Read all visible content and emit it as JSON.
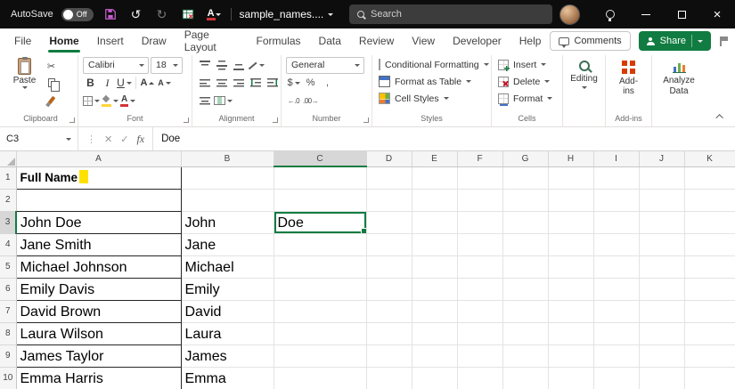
{
  "titlebar": {
    "autosave_label": "AutoSave",
    "autosave_state": "Off",
    "doc_title": "sample_names....",
    "search_placeholder": "Search"
  },
  "tabs": {
    "file": "File",
    "home": "Home",
    "insert": "Insert",
    "draw": "Draw",
    "page_layout": "Page Layout",
    "formulas": "Formulas",
    "data": "Data",
    "review": "Review",
    "view": "View",
    "developer": "Developer",
    "help": "Help",
    "active": "Home",
    "comments_label": "Comments",
    "share_label": "Share"
  },
  "ribbon": {
    "paste": "Paste",
    "clipboard_group": "Clipboard",
    "font_name": "Calibri",
    "font_size": "18",
    "font_group": "Font",
    "alignment_group": "Alignment",
    "number_format": "General",
    "number_group": "Number",
    "conditional_formatting": "Conditional Formatting",
    "format_as_table": "Format as Table",
    "cell_styles": "Cell Styles",
    "styles_group": "Styles",
    "insert": "Insert",
    "delete": "Delete",
    "format": "Format",
    "cells_group": "Cells",
    "editing": "Editing",
    "addins": "Add-ins",
    "addins_group": "Add-ins",
    "analyze_data": "Analyze Data"
  },
  "glyphs": {
    "undo": "↺",
    "redo": "↻",
    "cut": "✂",
    "bold": "B",
    "italic": "I",
    "underline": "U",
    "A": "A",
    "dollar": "$",
    "percent": "%",
    "comma": ",",
    "inc_decimal": "←.0",
    "dec_decimal": ".00→",
    "more": "⋮",
    "cancel": "✕",
    "check": "✓",
    "fx": "fx",
    "close": "×"
  },
  "formula_bar": {
    "name_box": "C3",
    "value": "Doe"
  },
  "sheet": {
    "columns": [
      "A",
      "B",
      "C",
      "D",
      "E",
      "F",
      "G",
      "H",
      "I",
      "J",
      "K"
    ],
    "selected_cell": "C3",
    "rows": [
      {
        "n": "1",
        "a": "Full Name",
        "b": "",
        "c": ""
      },
      {
        "n": "2",
        "a": "",
        "b": "",
        "c": ""
      },
      {
        "n": "3",
        "a": "John Doe",
        "b": "John",
        "c": "Doe"
      },
      {
        "n": "4",
        "a": "Jane Smith",
        "b": "Jane",
        "c": ""
      },
      {
        "n": "5",
        "a": "Michael Johnson",
        "b": "Michael",
        "c": ""
      },
      {
        "n": "6",
        "a": "Emily Davis",
        "b": "Emily",
        "c": ""
      },
      {
        "n": "7",
        "a": "David Brown",
        "b": "David",
        "c": ""
      },
      {
        "n": "8",
        "a": "Laura Wilson",
        "b": "Laura",
        "c": ""
      },
      {
        "n": "9",
        "a": "James Taylor",
        "b": "James",
        "c": ""
      },
      {
        "n": "10",
        "a": "Emma Harris",
        "b": "Emma",
        "c": ""
      }
    ]
  },
  "colors": {
    "accent_green": "#107C41",
    "selection_green": "#107C41",
    "highlight_yellow": "#FFE100",
    "addins_red": "#D83B01",
    "titlebar_black": "#0D0D0D"
  }
}
